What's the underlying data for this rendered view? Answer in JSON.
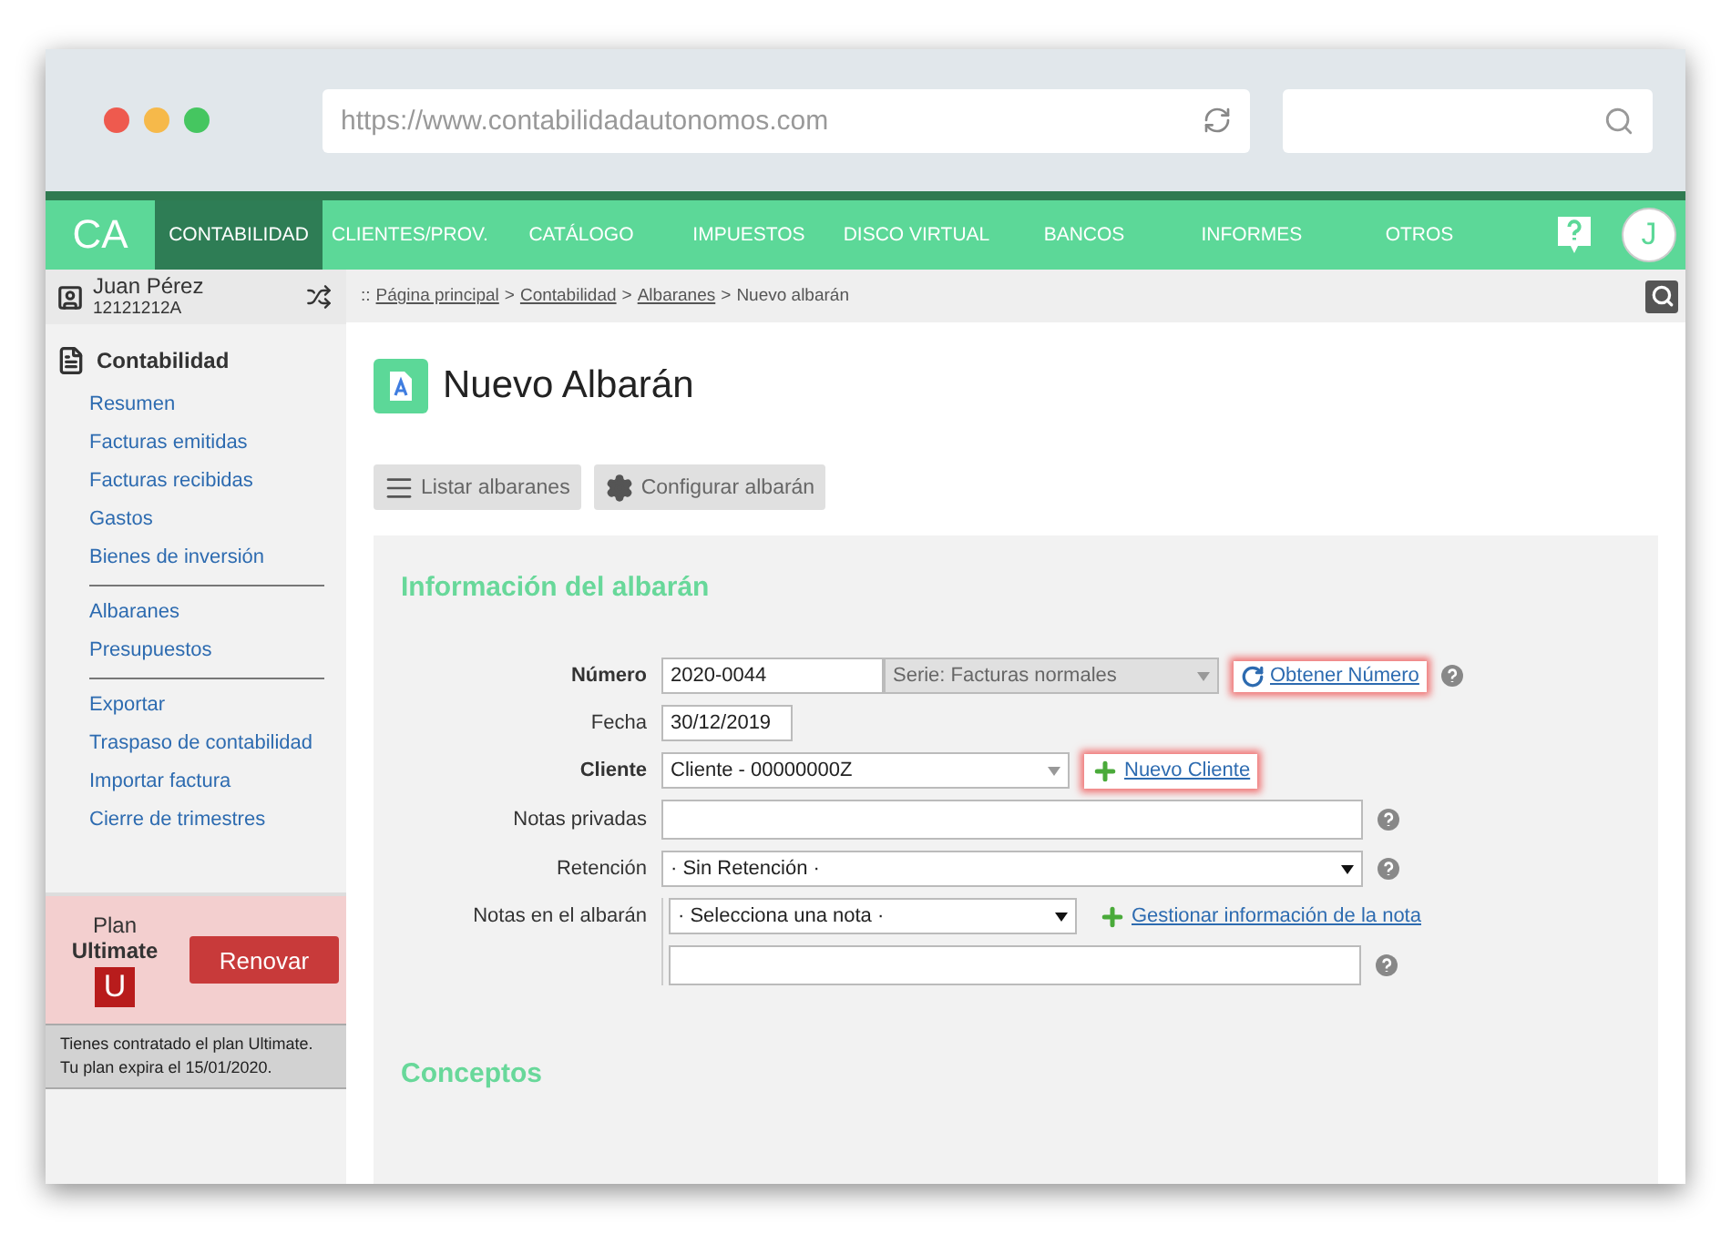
{
  "browser": {
    "url": "https://www.contabilidadautonomos.com"
  },
  "nav": {
    "logo": "CA",
    "avatar": "J",
    "items": [
      {
        "label": "CONTABILIDAD",
        "selected": true
      },
      {
        "label": "CLIENTES/PROV.",
        "selected": false
      },
      {
        "label": "CATÁLOGO",
        "selected": false
      },
      {
        "label": "IMPUESTOS",
        "selected": false
      },
      {
        "label": "DISCO VIRTUAL",
        "selected": false
      },
      {
        "label": "BANCOS",
        "selected": false
      },
      {
        "label": "INFORMES",
        "selected": false
      },
      {
        "label": "OTROS",
        "selected": false
      }
    ]
  },
  "user": {
    "name": "Juan Pérez",
    "id": "12121212A"
  },
  "sidebar": {
    "section": "Contabilidad",
    "groups": [
      [
        "Resumen",
        "Facturas emitidas",
        "Facturas recibidas",
        "Gastos",
        "Bienes de inversión"
      ],
      [
        "Albaranes",
        "Presupuestos"
      ],
      [
        "Exportar",
        "Traspaso de contabilidad",
        "Importar factura",
        "Cierre de trimestres"
      ]
    ]
  },
  "plan": {
    "label": "Plan",
    "name": "Ultimate",
    "badge": "U",
    "button": "Renovar",
    "note": [
      "Tienes contratado el plan Ultimate.",
      "Tu plan expira el 15/01/2020."
    ]
  },
  "breadcrumb": {
    "prefix": "::",
    "separator": ">",
    "links": [
      "Página principal",
      "Contabilidad",
      "Albaranes"
    ],
    "current": "Nuevo albarán"
  },
  "page": {
    "title": "Nuevo Albarán",
    "buttons": [
      {
        "label": "Listar albaranes",
        "kind": "list"
      },
      {
        "label": "Configurar albarán",
        "kind": "settings"
      }
    ]
  },
  "form": {
    "title": "Información del albarán",
    "fields": [
      {
        "kind": "number",
        "label": "Número",
        "required": true,
        "value": "2020-0044",
        "series": "Serie: Facturas normales",
        "link": "Obtener Número",
        "highlighted": true,
        "help": true
      },
      {
        "kind": "date",
        "label": "Fecha",
        "required": false,
        "value": "30/12/2019",
        "help": false
      },
      {
        "kind": "client",
        "label": "Cliente",
        "required": true,
        "value": "Cliente - 00000000Z",
        "link": "Nuevo Cliente",
        "highlighted": true,
        "help": false
      },
      {
        "kind": "textarea",
        "label": "Notas privadas",
        "required": false,
        "help": true
      },
      {
        "kind": "select",
        "label": "Retención",
        "required": false,
        "value": "· Sin Retención ·",
        "help": true
      },
      {
        "kind": "notes",
        "label": "Notas en el albarán",
        "required": false,
        "value": "· Selecciona una nota ·",
        "link": "Gestionar información de la nota",
        "highlighted": false,
        "help": true
      }
    ]
  },
  "concepts": {
    "title": "Conceptos"
  }
}
